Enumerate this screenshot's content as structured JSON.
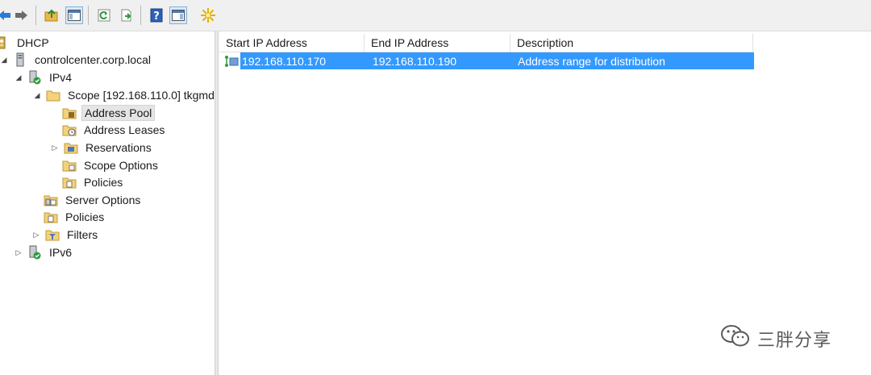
{
  "toolbar": {
    "buttons": [
      {
        "icon": "back-arrow-icon"
      },
      {
        "icon": "forward-arrow-icon"
      },
      {
        "icon": "up-folder-icon"
      },
      {
        "icon": "show-hide-console-tree-icon"
      },
      {
        "icon": "refresh-icon"
      },
      {
        "icon": "export-list-icon"
      },
      {
        "icon": "help-icon"
      },
      {
        "icon": "show-hide-action-pane-icon"
      },
      {
        "icon": "new-item-star-icon"
      }
    ]
  },
  "tree": {
    "items": [
      {
        "label": "DHCP",
        "icon": "dhcp-icon",
        "expander": ""
      },
      {
        "label": "controlcenter.corp.local",
        "icon": "server-icon",
        "expander": "expanded"
      },
      {
        "label": "IPv4",
        "icon": "ipv4-icon",
        "expander": "expanded"
      },
      {
        "label": "Scope [192.168.110.0] tkgmd",
        "icon": "scope-folder-icon",
        "expander": "expanded"
      },
      {
        "label": "Address Pool",
        "icon": "address-pool-icon",
        "expander": "",
        "selected": true
      },
      {
        "label": "Address Leases",
        "icon": "address-leases-icon",
        "expander": ""
      },
      {
        "label": "Reservations",
        "icon": "reservations-icon",
        "expander": "collapsed"
      },
      {
        "label": "Scope Options",
        "icon": "scope-options-icon",
        "expander": ""
      },
      {
        "label": "Policies",
        "icon": "policies-icon",
        "expander": ""
      },
      {
        "label": "Server Options",
        "icon": "server-options-icon",
        "expander": ""
      },
      {
        "label": "Policies",
        "icon": "policies-icon",
        "expander": ""
      },
      {
        "label": "Filters",
        "icon": "filters-icon",
        "expander": "collapsed"
      },
      {
        "label": "IPv6",
        "icon": "ipv6-icon",
        "expander": "collapsed"
      }
    ]
  },
  "list": {
    "columns": [
      "Start IP Address",
      "End IP Address",
      "Description"
    ],
    "rows": [
      {
        "start": "192.168.110.170",
        "end": "192.168.110.190",
        "description": "Address range for distribution",
        "icon": "ip-range-icon",
        "selected": true
      }
    ]
  },
  "watermark": {
    "text": "三胖分享",
    "icon": "wechat-icon"
  },
  "colors": {
    "selection": "#3399ff",
    "toolbar": "#f0f0f0",
    "tree_selected": "#e5e5e5"
  }
}
